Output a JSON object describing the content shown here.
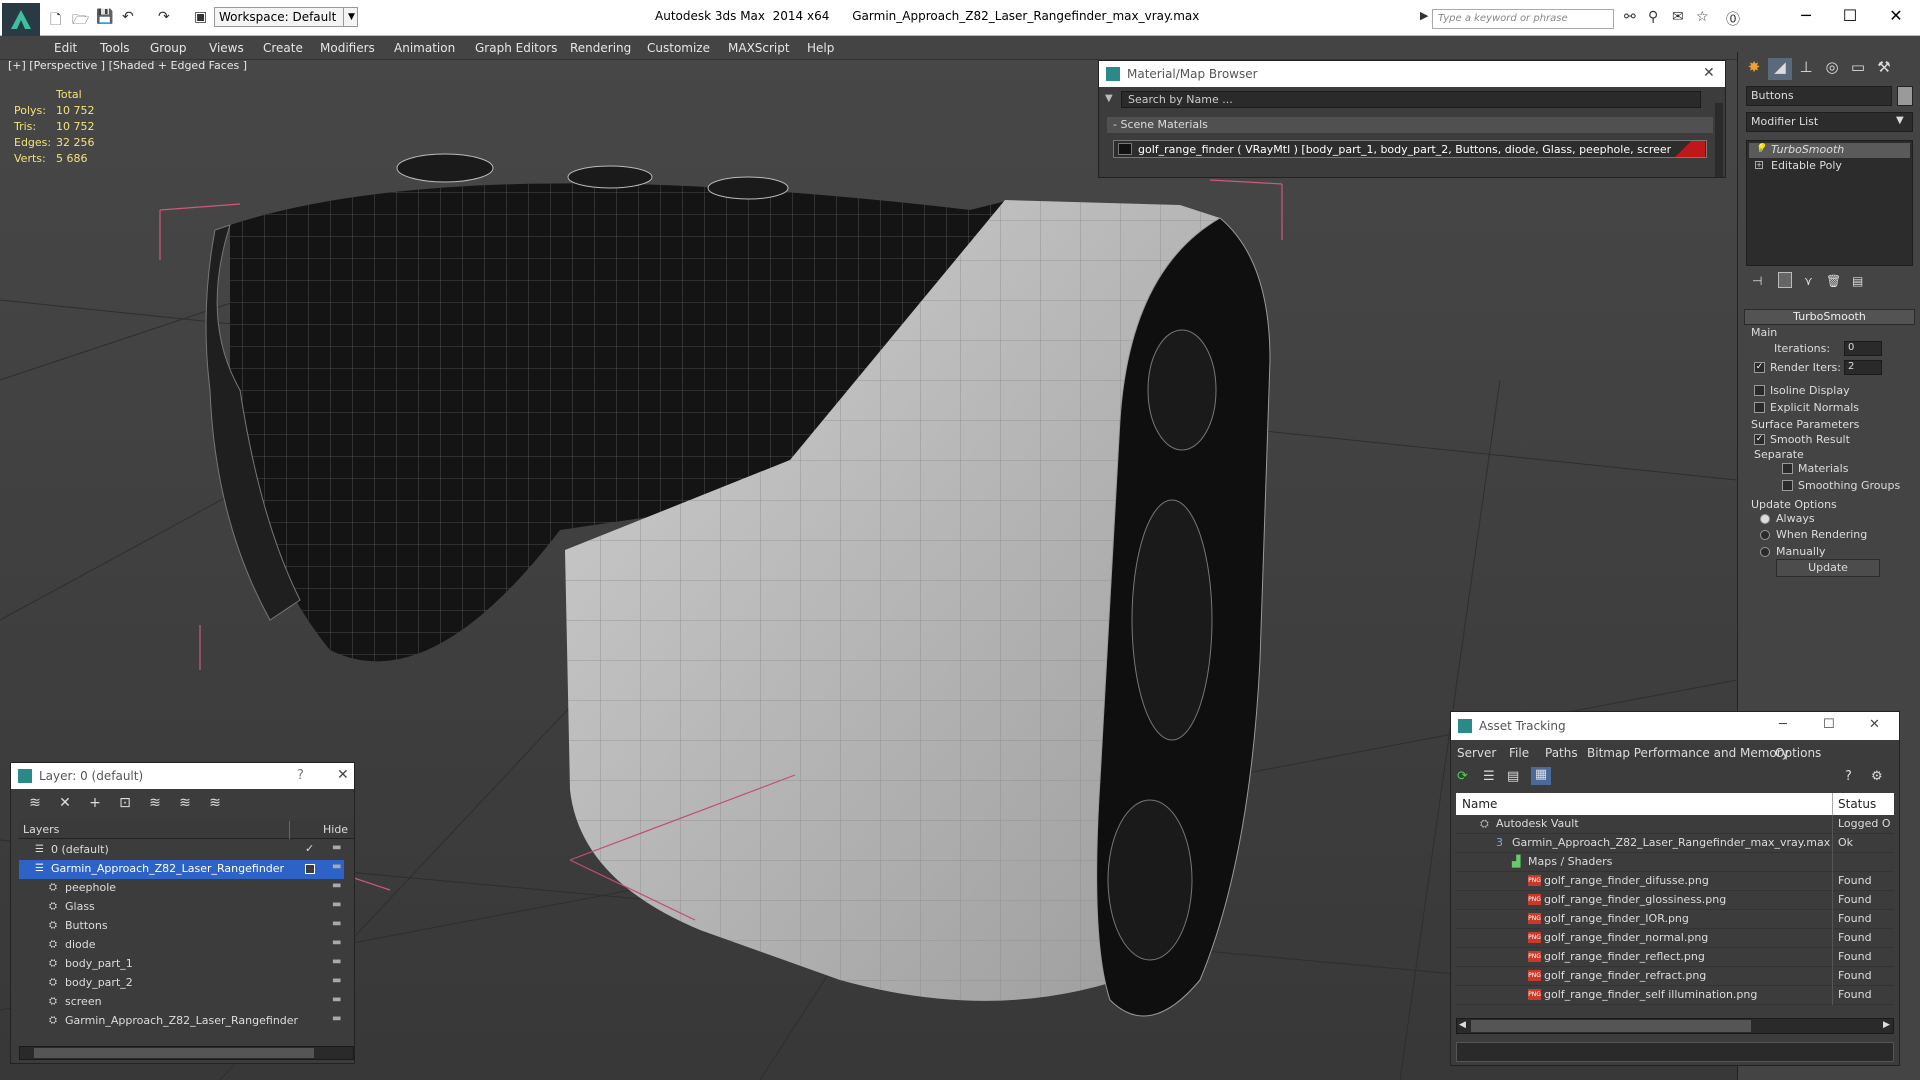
{
  "titlebar": {
    "workspace": "Workspace: Default",
    "app": "Autodesk 3ds Max  2014 x64",
    "file": "Garmin_Approach_Z82_Laser_Rangefinder_max_vray.max",
    "search_placeholder": "Type a keyword or phrase"
  },
  "menu": [
    "Edit",
    "Tools",
    "Group",
    "Views",
    "Create",
    "Modifiers",
    "Animation",
    "Graph Editors",
    "Rendering",
    "Customize",
    "MAXScript",
    "Help"
  ],
  "viewport": {
    "label": "[+] [Perspective ] [Shaded + Edged Faces ]",
    "stats": {
      "total": "Total",
      "polys_label": "Polys:",
      "polys": "10 752",
      "tris_label": "Tris:",
      "tris": "10 752",
      "edges_label": "Edges:",
      "edges": "32 256",
      "verts_label": "Verts:",
      "verts": "5 686"
    }
  },
  "material_browser": {
    "title": "Material/Map Browser",
    "search": "Search by Name ...",
    "section": "- Scene Materials",
    "item": "golf_range_finder  ( VRayMtl )  [body_part_1, body_part_2, Buttons, diode, Glass, peephole, screen]"
  },
  "command_panel": {
    "object_name": "Buttons",
    "modifier_list": "Modifier List",
    "stack": [
      "TurboSmooth",
      "Editable Poly"
    ],
    "rollout": "TurboSmooth",
    "main": "Main",
    "iterations_label": "Iterations:",
    "iterations": "0",
    "render_iters_label": "Render Iters:",
    "render_iters": "2",
    "isoline": "Isoline Display",
    "explicit_normals": "Explicit Normals",
    "surface_params": "Surface Parameters",
    "smooth_result": "Smooth Result",
    "separate": "Separate",
    "materials": "Materials",
    "smoothing_groups": "Smoothing Groups",
    "update_options": "Update Options",
    "always": "Always",
    "when_rendering": "When Rendering",
    "manually": "Manually",
    "update_btn": "Update"
  },
  "layers": {
    "title": "Layer: 0 (default)",
    "col_layers": "Layers",
    "col_hide": "Hide",
    "rows": [
      {
        "name": "0 (default)",
        "indent": 0
      },
      {
        "name": "Garmin_Approach_Z82_Laser_Rangefinder",
        "indent": 0,
        "selected": true
      },
      {
        "name": "peephole",
        "indent": 1
      },
      {
        "name": "Glass",
        "indent": 1
      },
      {
        "name": "Buttons",
        "indent": 1
      },
      {
        "name": "diode",
        "indent": 1
      },
      {
        "name": "body_part_1",
        "indent": 1
      },
      {
        "name": "body_part_2",
        "indent": 1
      },
      {
        "name": "screen",
        "indent": 1
      },
      {
        "name": "Garmin_Approach_Z82_Laser_Rangefinder",
        "indent": 1
      }
    ]
  },
  "asset_tracking": {
    "title": "Asset Tracking",
    "menu": [
      "Server",
      "File",
      "Paths",
      "Bitmap Performance and Memory",
      "Options"
    ],
    "col_name": "Name",
    "col_status": "Status",
    "rows": [
      {
        "name": "Autodesk Vault",
        "status": "Logged O",
        "indent": 0,
        "icon": "vault"
      },
      {
        "name": "Garmin_Approach_Z82_Laser_Rangefinder_max_vray.max",
        "status": "Ok",
        "indent": 1,
        "icon": "max"
      },
      {
        "name": "Maps / Shaders",
        "status": "",
        "indent": 2,
        "icon": "maps"
      },
      {
        "name": "golf_range_finder_difusse.png",
        "status": "Found",
        "indent": 3,
        "icon": "png"
      },
      {
        "name": "golf_range_finder_glossiness.png",
        "status": "Found",
        "indent": 3,
        "icon": "png"
      },
      {
        "name": "golf_range_finder_IOR.png",
        "status": "Found",
        "indent": 3,
        "icon": "png"
      },
      {
        "name": "golf_range_finder_normal.png",
        "status": "Found",
        "indent": 3,
        "icon": "png"
      },
      {
        "name": "golf_range_finder_reflect.png",
        "status": "Found",
        "indent": 3,
        "icon": "png"
      },
      {
        "name": "golf_range_finder_refract.png",
        "status": "Found",
        "indent": 3,
        "icon": "png"
      },
      {
        "name": "golf_range_finder_self illumination.png",
        "status": "Found",
        "indent": 3,
        "icon": "png"
      }
    ]
  }
}
